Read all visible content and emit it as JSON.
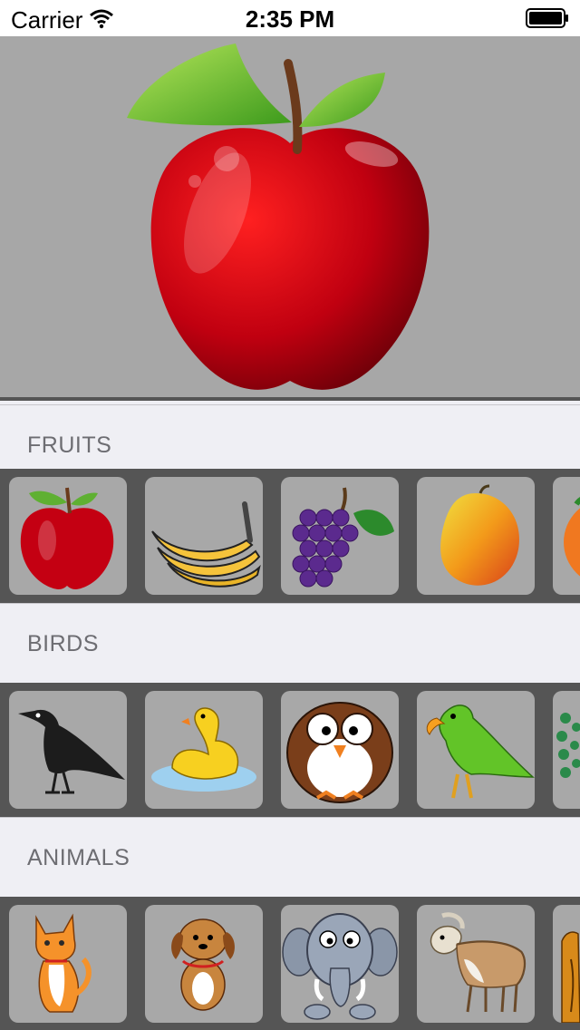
{
  "status_bar": {
    "carrier": "Carrier",
    "time": "2:35 PM"
  },
  "hero": {
    "image": "apple-icon"
  },
  "sections": [
    {
      "title": "FRUITS",
      "items": [
        "apple-icon",
        "banana-icon",
        "grapes-icon",
        "mango-icon",
        "orange-icon"
      ]
    },
    {
      "title": "BIRDS",
      "items": [
        "crow-icon",
        "duck-icon",
        "owl-icon",
        "parrot-icon",
        "peacock-icon"
      ]
    },
    {
      "title": "ANIMALS",
      "items": [
        "cat-icon",
        "dog-icon",
        "elephant-icon",
        "goat-icon",
        "lion-icon"
      ]
    }
  ],
  "colors": {
    "hero_bg": "#a7a7a7",
    "strip_bg": "#555555",
    "tile_bg": "#a8a8a8",
    "header_bg": "#efeff4",
    "header_text": "#6d6d72"
  }
}
